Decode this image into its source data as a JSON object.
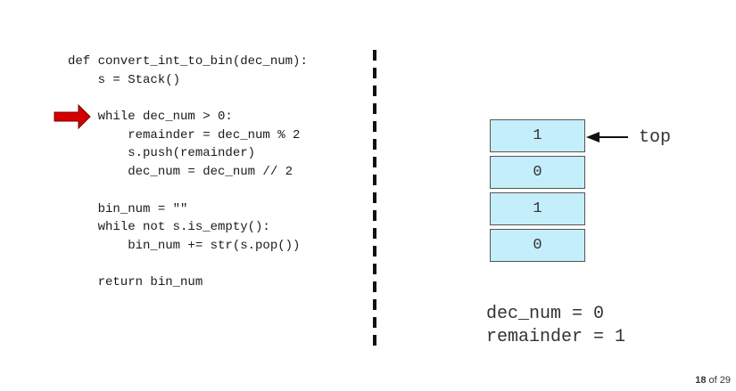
{
  "code": {
    "lines": [
      "def convert_int_to_bin(dec_num):",
      "    s = Stack()",
      "",
      "    while dec_num > 0:",
      "        remainder = dec_num % 2",
      "        s.push(remainder)",
      "        dec_num = dec_num // 2",
      "",
      "    bin_num = \"\"",
      "    while not s.is_empty():",
      "        bin_num += str(s.pop())",
      "",
      "    return bin_num"
    ],
    "current_line_index": 3
  },
  "stack": {
    "cells": [
      "1",
      "0",
      "1",
      "0"
    ],
    "top_label": "top"
  },
  "variables": {
    "dec_num_line": "dec_num = 0",
    "remainder_line": "remainder = 1"
  },
  "pagination": {
    "current": "18",
    "of_text": "of 29"
  },
  "colors": {
    "arrow": "#d40000",
    "stack_cell_fill": "#c5eefb",
    "stack_cell_border": "#555555"
  }
}
